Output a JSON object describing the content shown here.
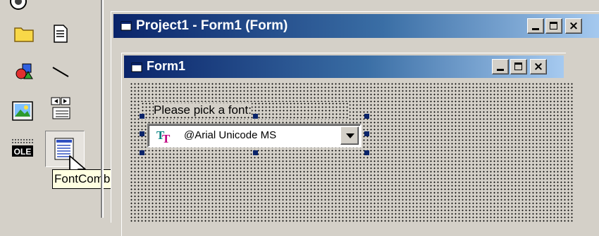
{
  "toolbox": {
    "items": [
      {
        "icon": "frame-icon"
      },
      {
        "icon": "textbox-icon"
      },
      {
        "icon": "shape-icon"
      },
      {
        "icon": "line-icon"
      },
      {
        "icon": "image-icon"
      },
      {
        "icon": "data-control-icon"
      },
      {
        "icon": "ole-icon",
        "label": "OLE"
      },
      {
        "icon": "fontcombo-icon"
      }
    ],
    "tooltip": "FontCombo"
  },
  "designer_window": {
    "title": "Project1 - Form1 (Form)",
    "buttons": {
      "minimize": "_",
      "maximize": "□",
      "close": "×"
    }
  },
  "form_window": {
    "title": "Form1",
    "label_caption": "Please pick a font:",
    "combo": {
      "value": "@Arial Unicode MS",
      "icon": "truetype-font-icon"
    }
  },
  "colors": {
    "titlebar_active_start": "#0a246a",
    "titlebar_active_end": "#a6caf0",
    "face": "#d4d0c8",
    "tooltip_bg": "#ffffe1",
    "handle": "#0a246a"
  }
}
